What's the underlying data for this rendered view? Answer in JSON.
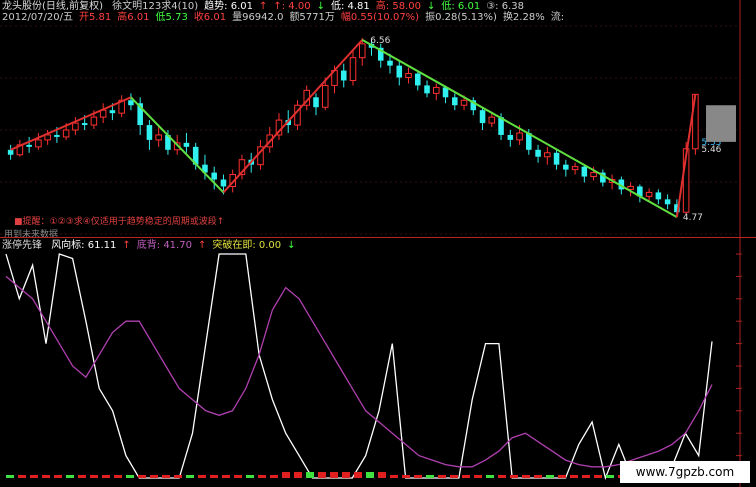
{
  "header": {
    "title": "龙头股份(日线,前复权)",
    "items": [
      {
        "label": "徐文明123求4(10)",
        "color": "#cccccc"
      },
      {
        "label": "趋势: 6.01",
        "color": "#ffffff"
      },
      {
        "label": "↑",
        "color": "#ff4040"
      },
      {
        "label": "↑: 4.00",
        "color": "#ff4040"
      },
      {
        "label": "↓",
        "color": "#40ff40"
      },
      {
        "label": "低: 4.81",
        "color": "#ffffff"
      },
      {
        "label": "高: 58.00",
        "color": "#ff4040"
      },
      {
        "label": "↓",
        "color": "#40ff40"
      },
      {
        "label": "低: 6.01",
        "color": "#40ff40"
      },
      {
        "label": "③: 6.38",
        "color": "#cccccc"
      }
    ]
  },
  "info": {
    "items": [
      {
        "label": "2012/07/20/五",
        "color": "#cccccc"
      },
      {
        "label": "开5.81",
        "color": "#ff4040"
      },
      {
        "label": "高6.01",
        "color": "#ff4040"
      },
      {
        "label": "低5.73",
        "color": "#40ff40"
      },
      {
        "label": "收6.01",
        "color": "#ff4040"
      },
      {
        "label": "量96942.0",
        "color": "#cccccc"
      },
      {
        "label": "额5771万",
        "color": "#cccccc"
      },
      {
        "label": "幅0.55(10.07%)",
        "color": "#ff4040"
      },
      {
        "label": "振0.28(5.13%)",
        "color": "#cccccc"
      },
      {
        "label": "换2.28%",
        "color": "#cccccc"
      },
      {
        "label": "流:",
        "color": "#cccccc"
      }
    ]
  },
  "notes": {
    "warning": "■提醒：①②③求④仅适用于趋势稳定的周期或波段↑",
    "future": "用到未来数据"
  },
  "indicator_legend": {
    "name": "涨停先锋",
    "items": [
      {
        "label": "风向标: 61.11",
        "color": "#ffffff"
      },
      {
        "label": "↑",
        "color": "#ff4040"
      },
      {
        "label": "底背: 41.70",
        "color": "#c060c0"
      },
      {
        "label": "↑",
        "color": "#ff4040"
      },
      {
        "label": "突破在即: 0.00",
        "color": "#e0e040"
      },
      {
        "label": "↓",
        "color": "#40ff40"
      }
    ]
  },
  "watermark": "www.7gpzb.com",
  "colors": {
    "up": "#ff3030",
    "down": "#30f0f0",
    "trend_up": "#e03030",
    "trend_down": "#60e040",
    "wind": "#ffffff",
    "fund": "#b040b0"
  },
  "chart_data": [
    {
      "type": "candlestick",
      "title": "",
      "annotations": [
        "6.56",
        "5.53",
        "5.46",
        "4.77"
      ],
      "ylim": [
        4.6,
        6.7
      ],
      "candles": [
        [
          5.45,
          5.4,
          5.5,
          5.35
        ],
        [
          5.4,
          5.5,
          5.55,
          5.38
        ],
        [
          5.5,
          5.48,
          5.58,
          5.42
        ],
        [
          5.48,
          5.55,
          5.62,
          5.45
        ],
        [
          5.55,
          5.6,
          5.65,
          5.5
        ],
        [
          5.6,
          5.58,
          5.68,
          5.52
        ],
        [
          5.58,
          5.65,
          5.72,
          5.55
        ],
        [
          5.65,
          5.72,
          5.78,
          5.6
        ],
        [
          5.72,
          5.7,
          5.8,
          5.65
        ],
        [
          5.7,
          5.78,
          5.85,
          5.66
        ],
        [
          5.78,
          5.85,
          5.92,
          5.72
        ],
        [
          5.85,
          5.82,
          5.92,
          5.75
        ],
        [
          5.82,
          5.95,
          6.0,
          5.78
        ],
        [
          5.95,
          5.9,
          6.02,
          5.85
        ],
        [
          5.92,
          5.7,
          5.98,
          5.6
        ],
        [
          5.7,
          5.55,
          5.75,
          5.45
        ],
        [
          5.55,
          5.6,
          5.68,
          5.48
        ],
        [
          5.6,
          5.45,
          5.65,
          5.4
        ],
        [
          5.45,
          5.52,
          5.6,
          5.4
        ],
        [
          5.52,
          5.48,
          5.62,
          5.42
        ],
        [
          5.48,
          5.3,
          5.52,
          5.25
        ],
        [
          5.3,
          5.22,
          5.4,
          5.15
        ],
        [
          5.22,
          5.15,
          5.28,
          5.05
        ],
        [
          5.15,
          5.08,
          5.2,
          5.0
        ],
        [
          5.08,
          5.2,
          5.25,
          5.02
        ],
        [
          5.2,
          5.35,
          5.4,
          5.15
        ],
        [
          5.35,
          5.3,
          5.42,
          5.22
        ],
        [
          5.3,
          5.48,
          5.55,
          5.25
        ],
        [
          5.48,
          5.6,
          5.68,
          5.42
        ],
        [
          5.6,
          5.75,
          5.82,
          5.55
        ],
        [
          5.75,
          5.7,
          5.85,
          5.62
        ],
        [
          5.7,
          5.9,
          5.95,
          5.65
        ],
        [
          5.9,
          6.05,
          6.1,
          5.85
        ],
        [
          5.98,
          5.88,
          6.02,
          5.8
        ],
        [
          5.88,
          6.1,
          6.18,
          5.85
        ],
        [
          6.1,
          6.25,
          6.3,
          6.02
        ],
        [
          6.25,
          6.15,
          6.32,
          6.08
        ],
        [
          6.15,
          6.38,
          6.45,
          6.1
        ],
        [
          6.38,
          6.52,
          6.58,
          6.3
        ],
        [
          6.52,
          6.48,
          6.56,
          6.4
        ],
        [
          6.48,
          6.35,
          6.52,
          6.28
        ],
        [
          6.35,
          6.3,
          6.42,
          6.22
        ],
        [
          6.3,
          6.18,
          6.35,
          6.1
        ],
        [
          6.18,
          6.22,
          6.28,
          6.12
        ],
        [
          6.22,
          6.1,
          6.25,
          6.05
        ],
        [
          6.1,
          6.02,
          6.15,
          5.98
        ],
        [
          6.02,
          6.08,
          6.12,
          5.95
        ],
        [
          6.08,
          5.98,
          6.1,
          5.92
        ],
        [
          5.98,
          5.9,
          6.02,
          5.85
        ],
        [
          5.9,
          5.95,
          6.0,
          5.85
        ],
        [
          5.95,
          5.85,
          5.98,
          5.8
        ],
        [
          5.85,
          5.72,
          5.88,
          5.65
        ],
        [
          5.72,
          5.78,
          5.82,
          5.68
        ],
        [
          5.78,
          5.6,
          5.82,
          5.55
        ],
        [
          5.6,
          5.55,
          5.65,
          5.48
        ],
        [
          5.55,
          5.62,
          5.7,
          5.5
        ],
        [
          5.62,
          5.45,
          5.66,
          5.4
        ],
        [
          5.45,
          5.38,
          5.5,
          5.32
        ],
        [
          5.38,
          5.42,
          5.48,
          5.3
        ],
        [
          5.42,
          5.3,
          5.45,
          5.25
        ],
        [
          5.3,
          5.25,
          5.35,
          5.18
        ],
        [
          5.25,
          5.28,
          5.32,
          5.2
        ],
        [
          5.28,
          5.18,
          5.3,
          5.12
        ],
        [
          5.18,
          5.22,
          5.28,
          5.14
        ],
        [
          5.22,
          5.12,
          5.25,
          5.08
        ],
        [
          5.12,
          5.15,
          5.2,
          5.05
        ],
        [
          5.15,
          5.05,
          5.18,
          5.0
        ],
        [
          5.05,
          5.08,
          5.12,
          4.98
        ],
        [
          5.08,
          4.98,
          5.1,
          4.92
        ],
        [
          4.98,
          5.02,
          5.06,
          4.92
        ],
        [
          5.02,
          4.95,
          5.05,
          4.9
        ],
        [
          4.95,
          4.9,
          5.0,
          4.85
        ],
        [
          4.9,
          4.82,
          4.95,
          4.77
        ],
        [
          4.82,
          5.46,
          5.53,
          4.8
        ],
        [
          5.46,
          6.01,
          6.01,
          5.4
        ]
      ],
      "trend_lines": [
        {
          "color": "trend_up",
          "from": [
            0,
            5.45
          ],
          "to": [
            13,
            5.98
          ]
        },
        {
          "color": "trend_down",
          "from": [
            13,
            5.98
          ],
          "to": [
            23,
            5.02
          ]
        },
        {
          "color": "trend_up",
          "from": [
            23,
            5.02
          ],
          "to": [
            38,
            6.56
          ]
        },
        {
          "color": "trend_down",
          "from": [
            38,
            6.56
          ],
          "to": [
            72,
            4.77
          ]
        },
        {
          "color": "trend_up",
          "from": [
            72,
            4.77
          ],
          "to": [
            74,
            6.01
          ]
        }
      ]
    },
    {
      "type": "line",
      "title": "涨停先锋",
      "ylim": [
        0,
        100
      ],
      "series": [
        {
          "name": "风向标",
          "color": "wind",
          "values": [
            100,
            80,
            95,
            60,
            100,
            98,
            70,
            40,
            30,
            10,
            0,
            0,
            0,
            0,
            20,
            60,
            100,
            100,
            100,
            55,
            35,
            20,
            10,
            0,
            0,
            0,
            0,
            10,
            30,
            60,
            0,
            0,
            0,
            0,
            0,
            35,
            60,
            60,
            0,
            0,
            0,
            0,
            0,
            15,
            25,
            0,
            15,
            0,
            0,
            0,
            5,
            20,
            10,
            61
          ]
        },
        {
          "name": "底背",
          "color": "fund",
          "values": [
            90,
            85,
            80,
            70,
            60,
            50,
            45,
            55,
            65,
            70,
            70,
            60,
            50,
            40,
            35,
            30,
            28,
            30,
            40,
            55,
            75,
            85,
            80,
            70,
            60,
            50,
            40,
            30,
            25,
            20,
            15,
            10,
            8,
            6,
            5,
            5,
            8,
            12,
            18,
            20,
            16,
            12,
            8,
            6,
            5,
            5,
            6,
            8,
            10,
            12,
            15,
            20,
            30,
            41.7
          ]
        }
      ]
    }
  ]
}
